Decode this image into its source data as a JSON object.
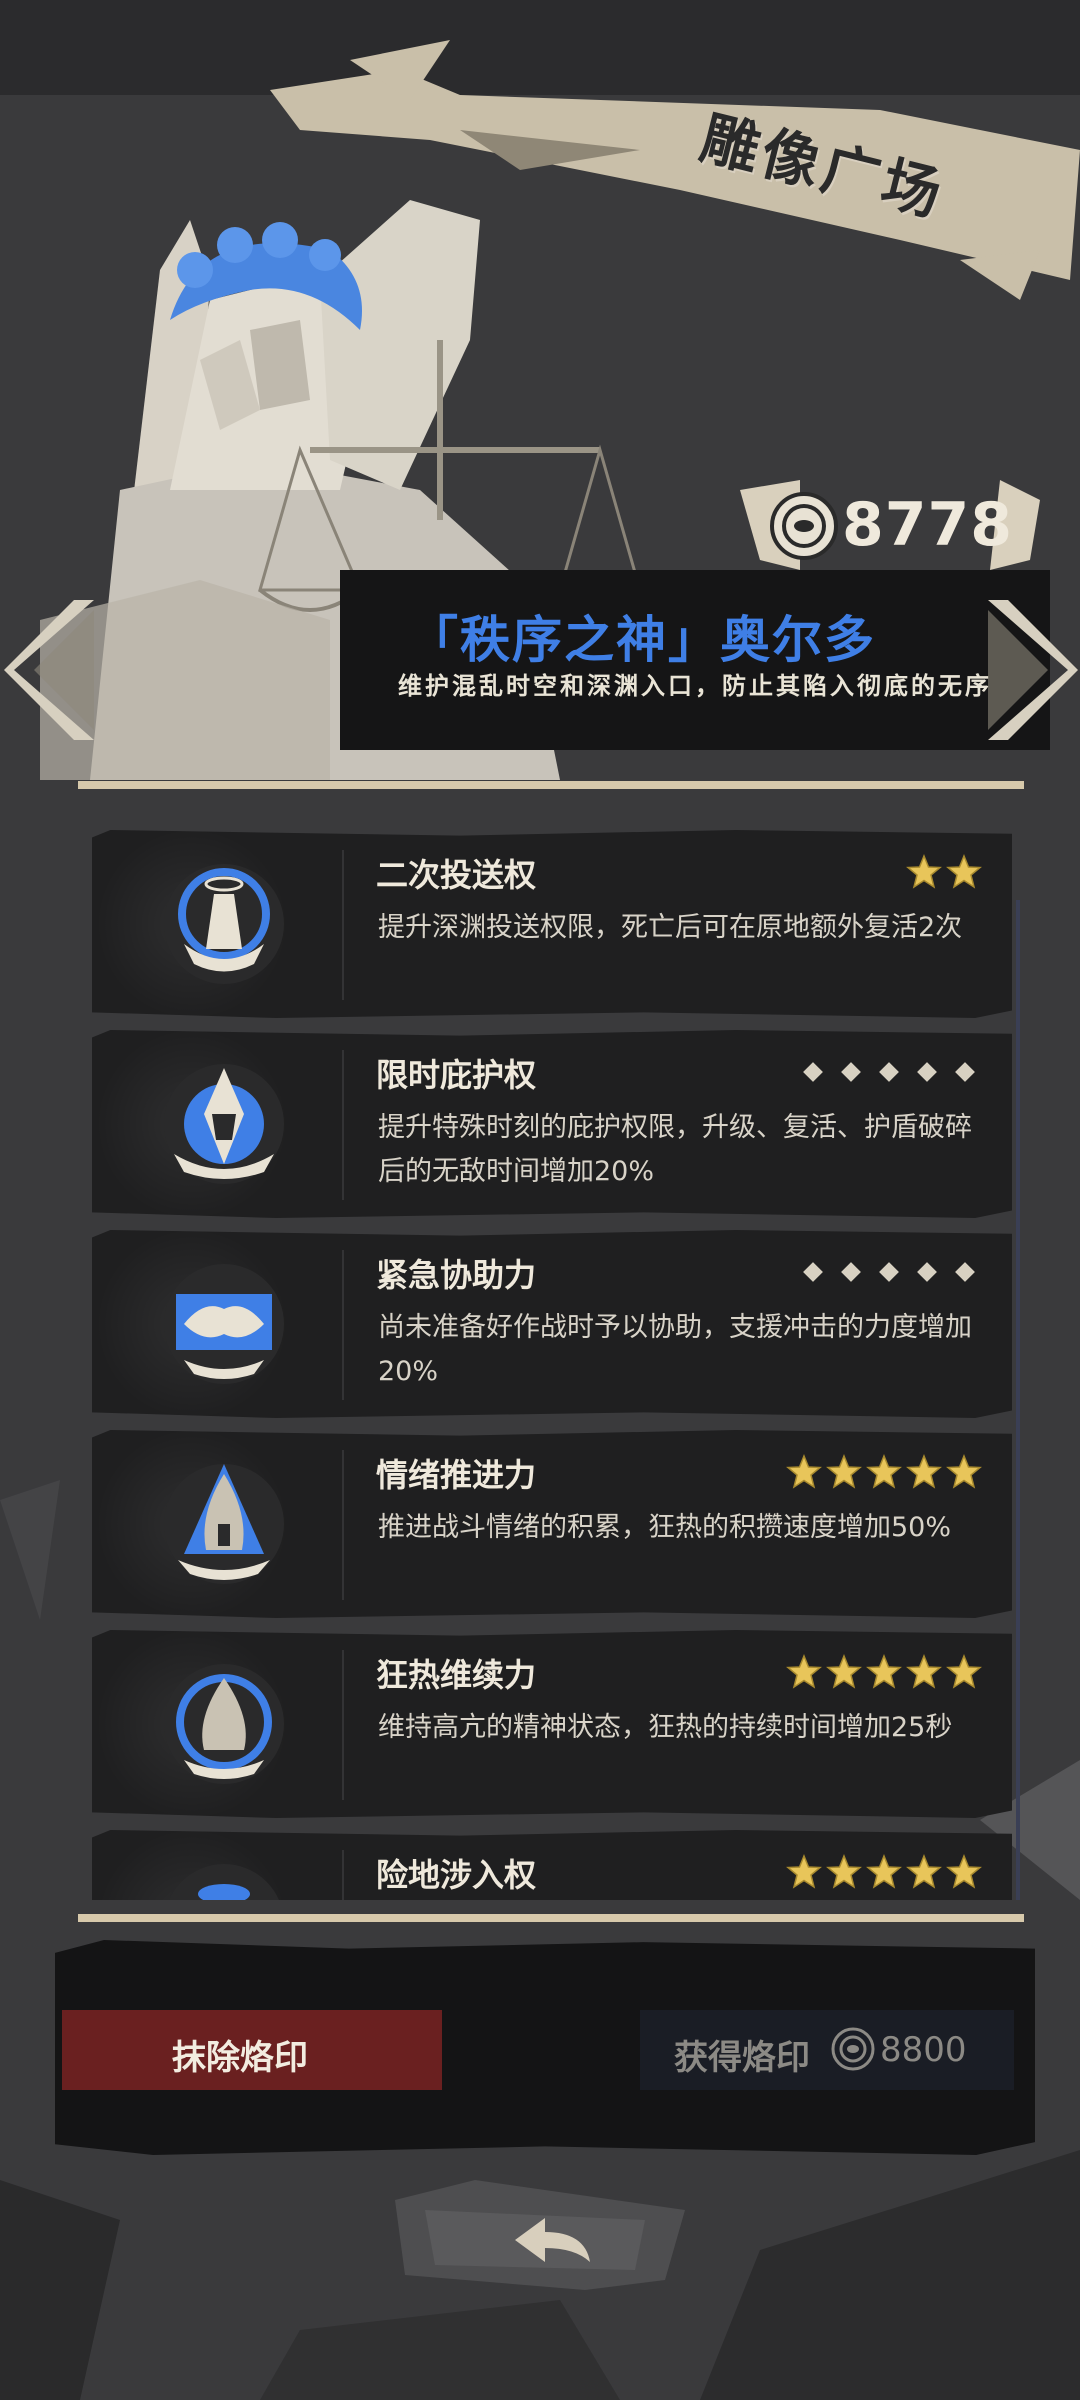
{
  "header": {
    "title": "雕像广场"
  },
  "currency": {
    "icon": "coin-icon",
    "amount": "8778"
  },
  "god": {
    "name": "「秩序之神」奥尔多",
    "description": "维护混乱时空和深渊入口，防止其陷入彻底的无序"
  },
  "colors": {
    "accent_blue": "#3f7fe6",
    "erase_red": "#6a2020",
    "star_gold": "#e8c55a",
    "panel": "#1f1f20"
  },
  "abilities": [
    {
      "name": "二次投送权",
      "description": "提升深渊投送权限，死亡后可在原地额外复活2次",
      "stars": 2,
      "max_stars": 5,
      "style": "stars",
      "icon": "angel-emblem-icon"
    },
    {
      "name": "限时庇护权",
      "description": "提升特殊时刻的庇护权限，升级、复活、护盾破碎后的无敌时间增加20%",
      "stars": 0,
      "max_stars": 5,
      "style": "dots",
      "icon": "shield-crown-icon"
    },
    {
      "name": "紧急协助力",
      "description": "尚未准备好作战时予以协助，支援冲击的力度增加20%",
      "stars": 0,
      "max_stars": 5,
      "style": "dots",
      "icon": "handshake-icon"
    },
    {
      "name": "情绪推进力",
      "description": "推进战斗情绪的积累，狂热的积攒速度增加50%",
      "stars": 5,
      "max_stars": 5,
      "style": "stars",
      "icon": "flame-spire-icon"
    },
    {
      "name": "狂热维续力",
      "description": "维持高亢的精神状态，狂热的持续时间增加25秒",
      "stars": 5,
      "max_stars": 5,
      "style": "stars",
      "icon": "flame-clock-icon"
    },
    {
      "name": "险地涉入权",
      "description": "",
      "stars": 5,
      "max_stars": 5,
      "style": "stars",
      "icon": "partial-emblem-icon"
    }
  ],
  "buttons": {
    "erase_label": "抹除烙印",
    "get_label": "获得烙印",
    "get_price": "8800",
    "back_icon": "back-arrow-icon"
  }
}
